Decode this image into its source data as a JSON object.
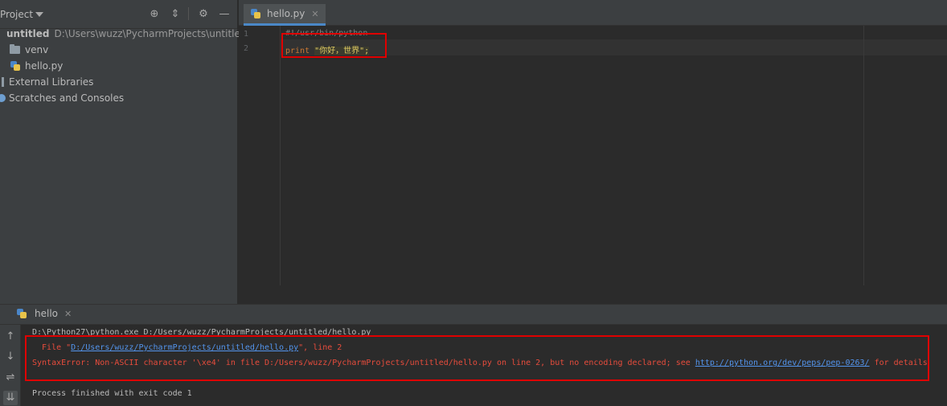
{
  "project": {
    "title": "Project",
    "tree": {
      "root_name": "untitled",
      "root_path": "D:\\Users\\wuzz\\PycharmProjects\\untitled",
      "venv": "venv",
      "file": "hello.py",
      "libs": "External Libraries",
      "scratches": "Scratches and Consoles"
    }
  },
  "editor": {
    "tab_label": "hello.py",
    "lines": [
      {
        "no": "1",
        "text": "#!/usr/bin/python"
      },
      {
        "no": "2",
        "kw": "print",
        "str": "\"你好，世界\";"
      }
    ]
  },
  "run": {
    "tab_label": "hello",
    "cmd": "D:\\Python27\\python.exe D:/Users/wuzz/PycharmProjects/untitled/hello.py",
    "err1_pre": "  File \"",
    "err1_link": "D:/Users/wuzz/PycharmProjects/untitled/hello.py",
    "err1_post": "\", line 2",
    "err2_pre": "SyntaxError: Non-ASCII character '\\xe4' in file D:/Users/wuzz/PycharmProjects/untitled/hello.py on line 2, but no encoding declared; see ",
    "err2_link": "http://python.org/dev/peps/pep-0263/",
    "err2_post": " for details",
    "exit": "Process finished with exit code 1"
  },
  "colors": {
    "background": "#2b2b2b",
    "panel": "#3c3f41",
    "error": "#e74c3c",
    "link": "#5394ec",
    "highlight_box": "#e00000"
  }
}
